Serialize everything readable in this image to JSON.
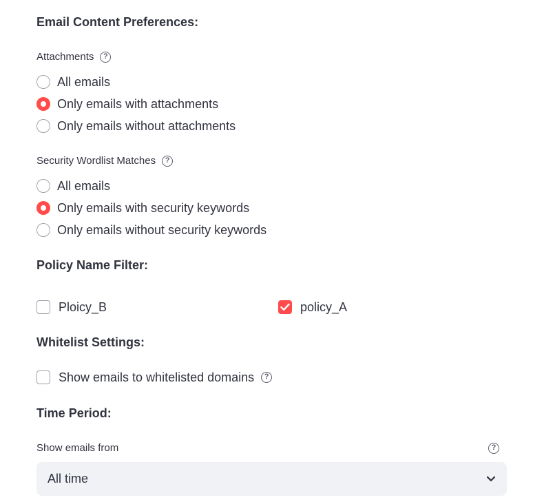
{
  "email_content": {
    "title": "Email Content Preferences:",
    "attachments": {
      "label": "Attachments",
      "options": [
        "All emails",
        "Only emails with attachments",
        "Only emails without attachments"
      ],
      "selected_index": 1
    },
    "security": {
      "label": "Security Wordlist Matches",
      "options": [
        "All emails",
        "Only emails with security keywords",
        "Only emails without security keywords"
      ],
      "selected_index": 1
    }
  },
  "policy": {
    "title": "Policy Name Filter:",
    "items": [
      {
        "label": "Ploicy_B",
        "checked": false
      },
      {
        "label": "policy_A",
        "checked": true
      }
    ]
  },
  "whitelist": {
    "title": "Whitelist Settings:",
    "option_label": "Show emails to whitelisted domains",
    "checked": false
  },
  "time_period": {
    "title": "Time Period:",
    "select_label": "Show emails from",
    "selected_value": "All time"
  },
  "colors": {
    "accent": "#ff4b4b",
    "text": "#31333f",
    "select_bg": "#f0f2f6"
  },
  "icons": {
    "help": "help-circle-icon",
    "dropdown": "chevron-down-icon",
    "check": "checkmark-icon"
  }
}
